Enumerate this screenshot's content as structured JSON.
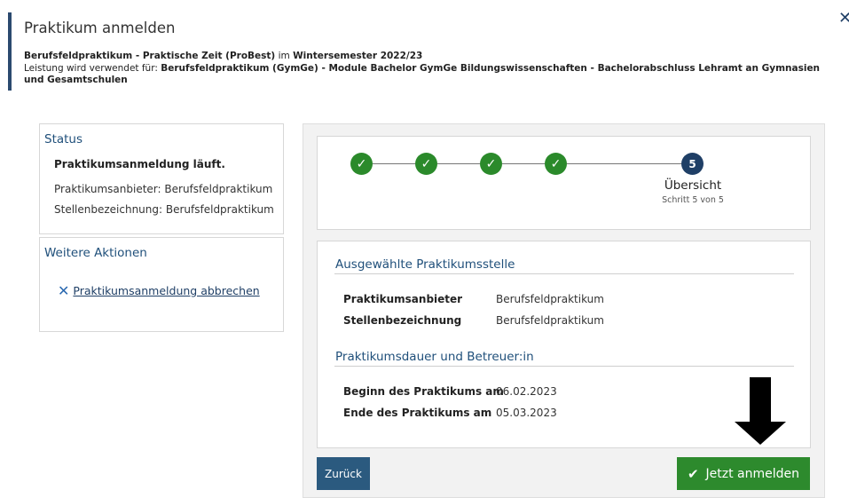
{
  "header": {
    "title": "Praktikum anmelden",
    "close_icon": "close-icon",
    "line1_bold_a": "Berufsfeldpraktikum - Praktische Zeit (ProBest)",
    "line1_mid": " im ",
    "line1_bold_b": "Wintersemester 2022/23",
    "line2_plain": "Leistung wird verwendet für: ",
    "line2_bold": "Berufsfeldpraktikum (GymGe) - Module Bachelor GymGe Bildungswissenschaften - Bachelorabschluss Lehramt an Gymnasien und Gesamtschulen"
  },
  "status": {
    "heading": "Status",
    "state": "Praktikumsanmeldung läuft.",
    "provider_line": "Praktikumsanbieter: Berufsfeldpraktikum",
    "position_line": "Stellenbezeichnung: Berufsfeldpraktikum"
  },
  "actions": {
    "heading": "Weitere Aktionen",
    "cancel_label": "Praktikumsanmeldung abbrechen"
  },
  "stepper": {
    "steps": [
      "✓",
      "✓",
      "✓",
      "✓",
      "5"
    ],
    "current_label": "Übersicht",
    "current_sub": "Schritt 5 von 5"
  },
  "section1": {
    "heading": "Ausgewählte Praktikumsstelle",
    "rows": [
      {
        "key": "Praktikumsanbieter",
        "value": "Berufsfeldpraktikum"
      },
      {
        "key": "Stellenbezeichnung",
        "value": "Berufsfeldpraktikum"
      }
    ]
  },
  "section2": {
    "heading": "Praktikumsdauer und Betreuer:in",
    "rows": [
      {
        "key": "Beginn des Praktikums am",
        "value": "06.02.2023"
      },
      {
        "key": "Ende des Praktikums am",
        "value": "05.03.2023"
      }
    ]
  },
  "buttons": {
    "back_label": "Zurück",
    "submit_label": "Jetzt anmelden"
  },
  "colors": {
    "accent": "#1f3f66",
    "success": "#2d8a2d",
    "link": "#1f4f7a"
  }
}
